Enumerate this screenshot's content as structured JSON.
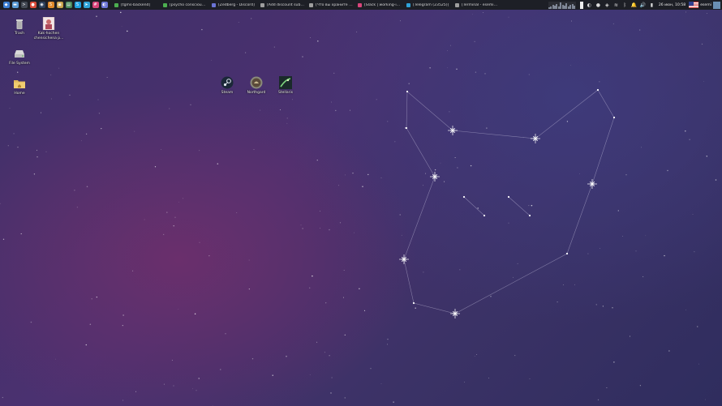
{
  "panel": {
    "launchers": [
      {
        "name": "whisker-menu-icon",
        "glyph": "◆",
        "color": "#3b7fd4"
      },
      {
        "name": "file-manager-icon",
        "glyph": "▬",
        "color": "#5b9bd5"
      },
      {
        "name": "terminal-icon",
        "glyph": ">",
        "color": "#444a55"
      },
      {
        "name": "chrome-icon",
        "glyph": "●",
        "color": "#d94b3a"
      },
      {
        "name": "steam-icon",
        "glyph": "◉",
        "color": "#2a3f5a"
      },
      {
        "name": "sublime-icon",
        "glyph": "S",
        "color": "#e08a2a"
      },
      {
        "name": "files-icon",
        "glyph": "▣",
        "color": "#c9a24a"
      },
      {
        "name": "image-viewer-icon",
        "glyph": "▤",
        "color": "#4a8a5a"
      },
      {
        "name": "skype-icon",
        "glyph": "S",
        "color": "#1fa0e0"
      },
      {
        "name": "telegram-icon",
        "glyph": "➤",
        "color": "#2fa3d9"
      },
      {
        "name": "slack-icon",
        "glyph": "#",
        "color": "#d9457b"
      },
      {
        "name": "discord-icon",
        "glyph": "◐",
        "color": "#6b74d6"
      }
    ],
    "tasks": [
      {
        "label": "[tgms-backend]",
        "color": "#4caf50"
      },
      {
        "label": "[psycho consciousu]",
        "color": "#4caf50"
      },
      {
        "label": "[Zedberg - Discord]",
        "color": "#6b74d6"
      },
      {
        "label": "[Add discount subcto with ti...",
        "color": "#9e9e9e"
      },
      {
        "label": "[Что вы храните на рабоч...",
        "color": "#9e9e9e"
      },
      {
        "label": "[Slack | working-issues | S...",
        "color": "#d9457b"
      },
      {
        "label": "[Telegram (23525)]",
        "color": "#2fa3d9"
      },
      {
        "label": "[Terminal - esemi@esemi-li...",
        "color": "#9e9e9e"
      }
    ],
    "cpu_graph": [
      0.2,
      0.3,
      0.5,
      0.4,
      0.6,
      0.3,
      0.8,
      0.5,
      0.4,
      0.7,
      0.3,
      0.5,
      0.6,
      0.4
    ],
    "tray_icons": [
      {
        "name": "discord-tray-icon",
        "glyph": "◐"
      },
      {
        "name": "chrome-tray-icon",
        "glyph": "●"
      },
      {
        "name": "network-tray-icon",
        "glyph": "◈"
      },
      {
        "name": "wifi-icon",
        "glyph": "≋"
      },
      {
        "name": "bluetooth-icon",
        "glyph": "ᛒ"
      },
      {
        "name": "notifications-icon",
        "glyph": "🔔"
      },
      {
        "name": "volume-icon",
        "glyph": "🔊"
      },
      {
        "name": "battery-icon",
        "glyph": "▮"
      }
    ],
    "clock": "26 июн, 10:58",
    "user": "esemi"
  },
  "desktop_icons": [
    {
      "name": "trash",
      "label": "Trash",
      "icon": "trash-icon"
    },
    {
      "name": "kak-hochen",
      "label": "Kak-hochen chensichena p...",
      "icon": "image-file-icon"
    },
    {
      "name": "file-system",
      "label": "File System",
      "icon": "drive-icon"
    },
    {
      "name": "home",
      "label": "Home",
      "icon": "home-folder-icon"
    },
    {
      "name": "steam",
      "label": "Steam",
      "icon": "steam-app-icon"
    },
    {
      "name": "northgard",
      "label": "Northgard",
      "icon": "northgard-app-icon"
    },
    {
      "name": "stellaris",
      "label": "Stellaris",
      "icon": "stellaris-app-icon"
    }
  ],
  "colors": {
    "panel": "#1d1f26",
    "accent": "#3b7fd4"
  }
}
